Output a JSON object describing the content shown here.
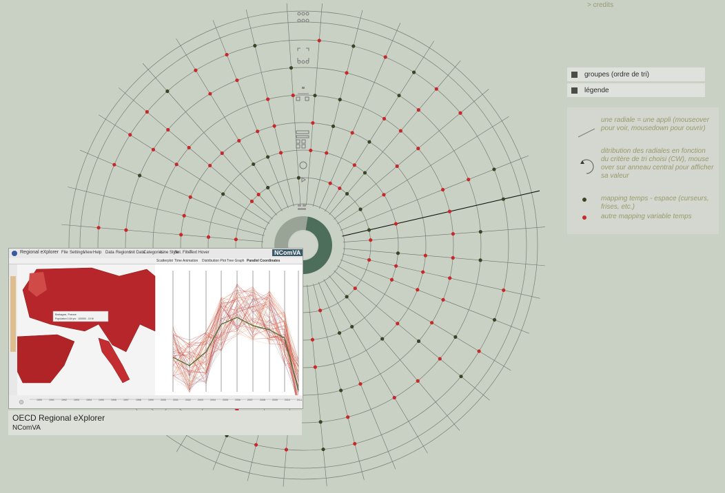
{
  "credits": "> credits",
  "menu": {
    "groups_label": "groupes (ordre de tri)",
    "legend_label": "légende"
  },
  "legend": {
    "radial_text": "une radiale = une appli (mouseover pour voir, mousedown pour ouvrir)",
    "distribution_text": "ditribution des radiales en fonction du critère de tri choisi (CW), mouse over sur anneau central pour afficher sa valeur",
    "space_text": "mapping temps - espace (curseurs, frises, etc.)",
    "other_text": "autre mapping variable temps"
  },
  "colors": {
    "background": "#c9d0c4",
    "dot_space": "#3b4426",
    "dot_other": "#c8282a",
    "ring_line": "#7a7e76",
    "center": "#4e6e5c"
  },
  "preview": {
    "app_title": "Regional eXplorer",
    "menu_items": [
      "File",
      "Settings",
      "View",
      "Help"
    ],
    "toolbar_items": [
      "Data",
      "Regions",
      "Init Data",
      "Categories",
      "Line Style",
      "Sel. Filter",
      "Text Hover"
    ],
    "tabs": [
      "Scatterplot",
      "Time Animation",
      "Distribution Plot",
      "Tree Graph",
      "Parallel Coordinates"
    ],
    "logo": "NComVA",
    "tooltip_title": "Bretagne, France",
    "tooltip_value": "Population 0-64 yrs : 100000 - 10 M",
    "timeline_years": [
      "1990",
      "1991",
      "1992",
      "1993",
      "1994",
      "1995",
      "1996",
      "1997",
      "1998",
      "1999",
      "2000",
      "2001",
      "2002",
      "2003",
      "2004",
      "2005",
      "2006",
      "2007",
      "2008",
      "2009",
      "2010",
      "2011"
    ]
  },
  "caption": {
    "title": "OECD Regional eXplorer",
    "subtitle": "NComVA"
  },
  "radial_icons": [
    "group-icon-dots",
    "group-icon-bracket",
    "group-icon-squares",
    "group-icon-list",
    "group-icon-cycle",
    "group-icon-grid"
  ]
}
